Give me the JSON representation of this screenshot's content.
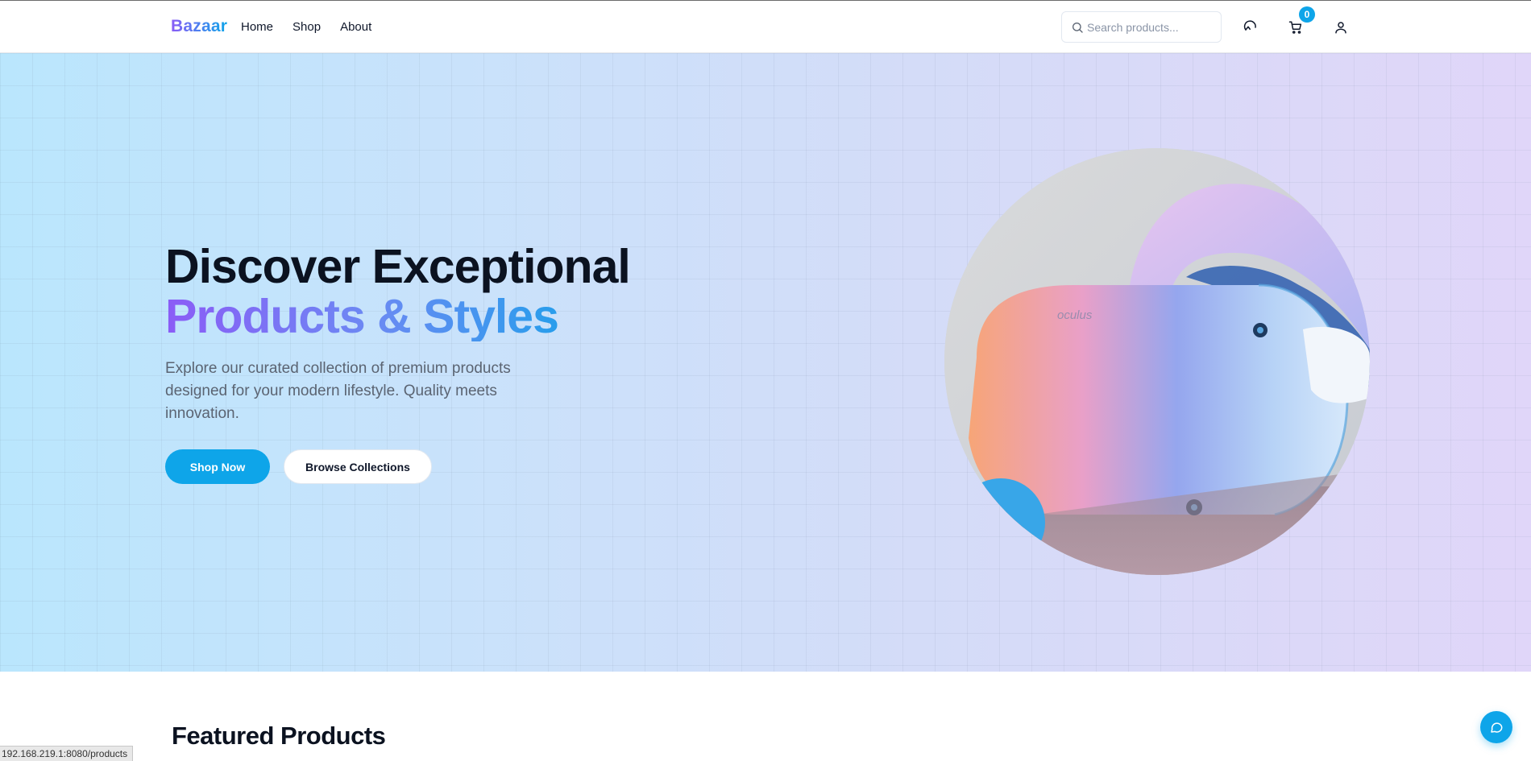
{
  "header": {
    "logo": "Bazaar",
    "nav": [
      "Home",
      "Shop",
      "About"
    ],
    "search_placeholder": "Search products...",
    "cart_count": "0"
  },
  "hero": {
    "title_line1": "Discover Exceptional",
    "title_line2": "Products & Styles",
    "description": "Explore our curated collection of premium products designed for your modern lifestyle. Quality meets innovation.",
    "primary_button": "Shop Now",
    "secondary_button": "Browse Collections",
    "image_brand_text": "oculus"
  },
  "featured": {
    "title": "Featured Products"
  },
  "status_bar": {
    "url": "192.168.219.1:8080/products"
  },
  "colors": {
    "accent": "#0ea5e9",
    "gradient_start": "#8b5cf6",
    "text_dark": "#0b1220"
  }
}
